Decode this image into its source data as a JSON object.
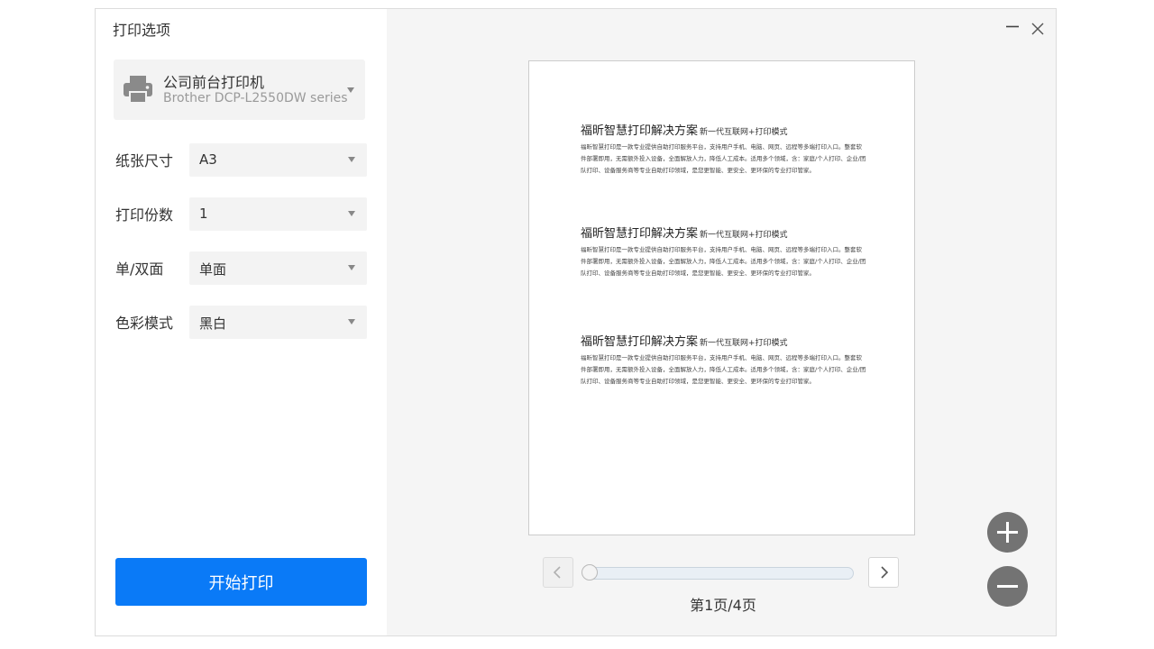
{
  "dialog": {
    "title": "打印选项"
  },
  "printer": {
    "name": "公司前台打印机",
    "model": "Brother DCP-L2550DW series",
    "icon": "printer-icon"
  },
  "options": [
    {
      "label": "纸张尺寸",
      "value": "A3"
    },
    {
      "label": "打印份数",
      "value": "1"
    },
    {
      "label": "单/双面",
      "value": "单面"
    },
    {
      "label": "色彩模式",
      "value": "黑白"
    }
  ],
  "actions": {
    "print_label": "开始打印"
  },
  "window": {
    "minimize_icon": "minimize-icon",
    "close_icon": "close-icon"
  },
  "preview": {
    "blocks": [
      {
        "title": "福昕智慧打印解决方案",
        "subtitle": "新一代互联网+打印模式",
        "body": "福昕智慧打印是一款专业提供自助打印服务平台，支持用户手机、电脑、网页、远程等多端打印入口。整套软件部署即用，无需额外投入设备，全面解放人力，降低人工成本。适用多个领域，含：家庭/个人打印、企业/团队打印、设备服务商等专业自助打印领域，是您更智能、更安全、更环保的专业打印管家。"
      },
      {
        "title": "福昕智慧打印解决方案",
        "subtitle": "新一代互联网+打印模式",
        "body": "福昕智慧打印是一款专业提供自助打印服务平台，支持用户手机、电脑、网页、远程等多端打印入口。整套软件部署即用，无需额外投入设备，全面解放人力，降低人工成本。适用多个领域，含：家庭/个人打印、企业/团队打印、设备服务商等专业自助打印领域，是您更智能、更安全、更环保的专业打印管家。"
      },
      {
        "title": "福昕智慧打印解决方案",
        "subtitle": "新一代互联网+打印模式",
        "body": "福昕智慧打印是一款专业提供自助打印服务平台，支持用户手机、电脑、网页、远程等多端打印入口。整套软件部署即用，无需额外投入设备，全面解放人力，降低人工成本。适用多个领域，含：家庭/个人打印、企业/团队打印、设备服务商等专业自助打印领域，是您更智能、更安全、更环保的专业打印管家。"
      }
    ]
  },
  "pager": {
    "indicator": "第1页/4页",
    "current_page": 1,
    "total_pages": 4,
    "prev_icon": "chevron-left-icon",
    "next_icon": "chevron-right-icon"
  },
  "zoom": {
    "in_icon": "zoom-in-icon",
    "out_icon": "zoom-out-icon"
  }
}
